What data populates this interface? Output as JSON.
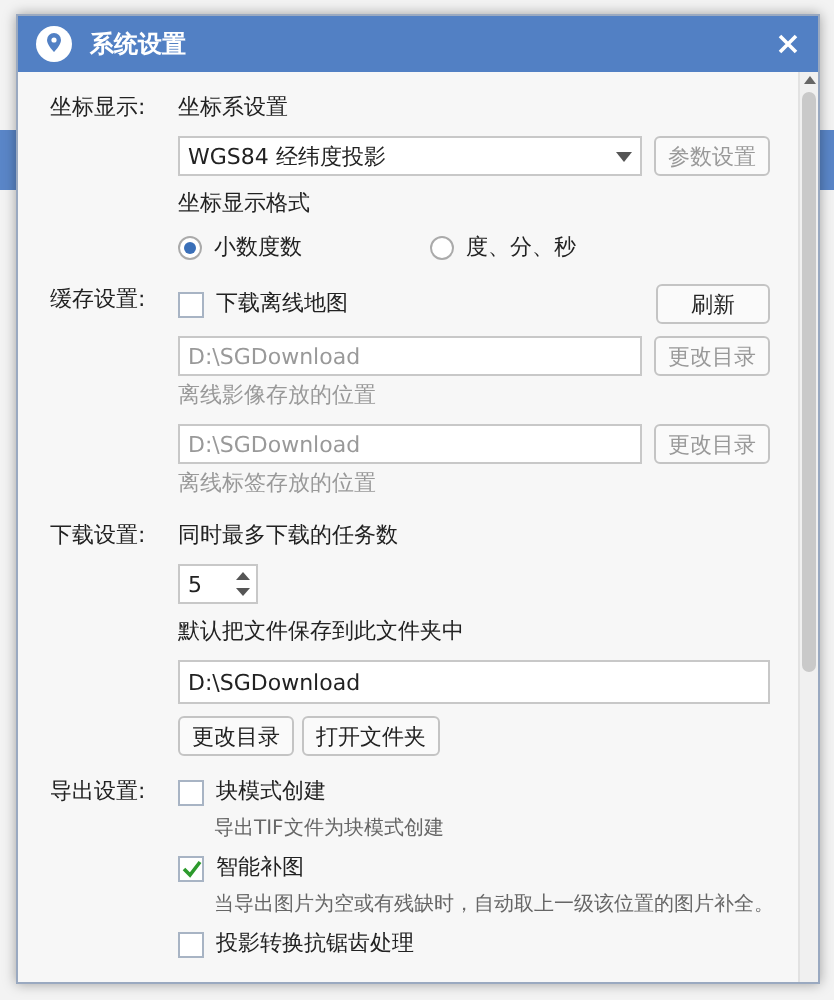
{
  "window": {
    "title": "系统设置"
  },
  "coordinate": {
    "label": "坐标显示:",
    "system_heading": "坐标系设置",
    "system_value": "WGS84 经纬度投影",
    "params_button": {
      "label": "参数设置",
      "disabled": true
    },
    "format_heading": "坐标显示格式",
    "formats": [
      {
        "label": "小数度数",
        "selected": true
      },
      {
        "label": "度、分、秒",
        "selected": false
      }
    ]
  },
  "cache": {
    "label": "缓存设置:",
    "offline": {
      "label": "下载离线地图",
      "checked": false
    },
    "refresh_button": "刷新",
    "paths": [
      {
        "value": "D:\\SGDownload",
        "button": "更改目录",
        "hint": "离线影像存放的位置",
        "disabled": true
      },
      {
        "value": "D:\\SGDownload",
        "button": "更改目录",
        "hint": "离线标签存放的位置",
        "disabled": true
      }
    ]
  },
  "download": {
    "label": "下载设置:",
    "tasks_heading": "同时最多下载的任务数",
    "tasks_value": "5",
    "folder_heading": "默认把文件保存到此文件夹中",
    "folder_value": "D:\\SGDownload",
    "buttons": [
      "更改目录",
      "打开文件夹"
    ]
  },
  "export": {
    "label": "导出设置:",
    "options": [
      {
        "label": "块模式创建",
        "checked": false,
        "hint": "导出TIF文件为块模式创建"
      },
      {
        "label": "智能补图",
        "checked": true,
        "hint": "当导出图片为空或有残缺时，自动取上一级该位置的图片补全。"
      },
      {
        "label": "投影转换抗锯齿处理",
        "checked": false
      }
    ]
  }
}
